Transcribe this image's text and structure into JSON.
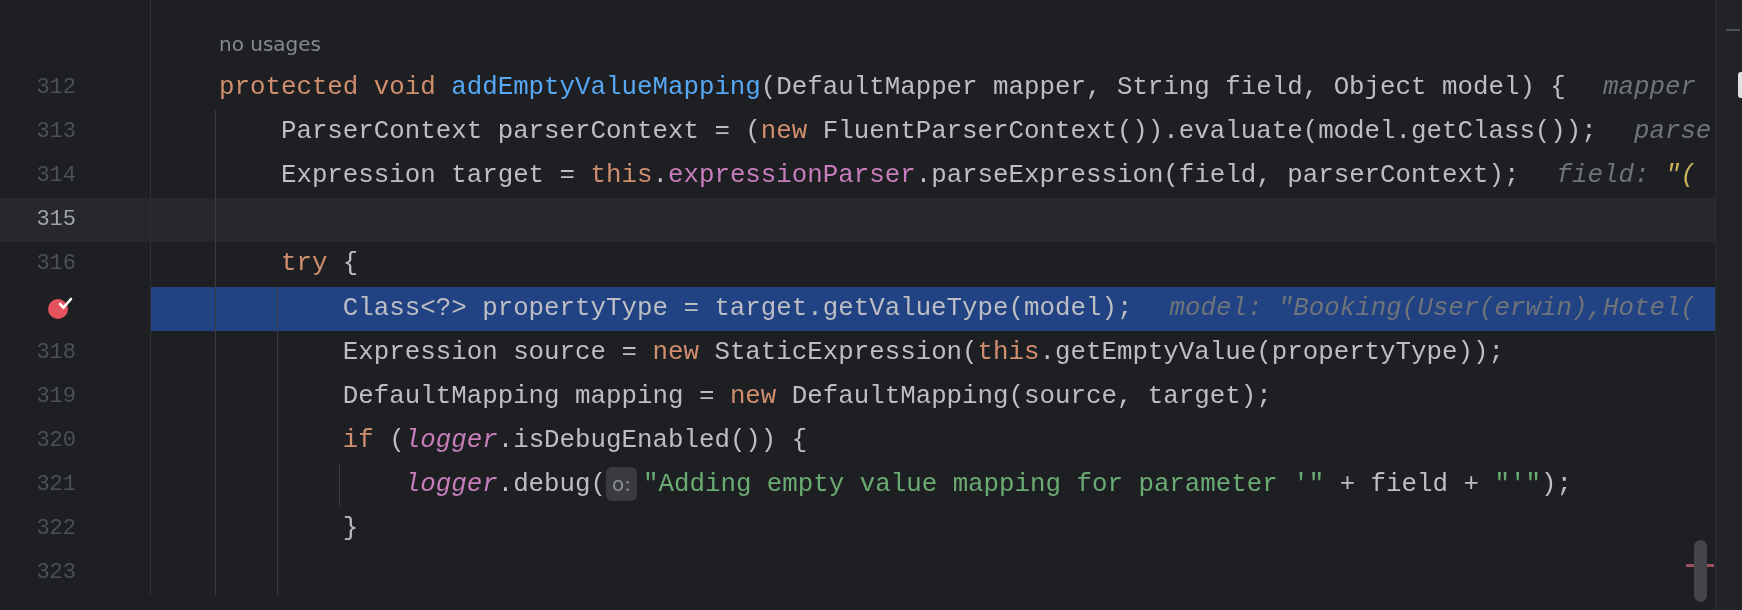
{
  "editor": {
    "lines": [
      {
        "kind": "usage_hint",
        "text": "no usages"
      },
      {
        "kind": "code",
        "number": "312",
        "current": false,
        "selected": false,
        "breakpoint": false,
        "tokens": [
          {
            "kind": "keyword",
            "text": "protected "
          },
          {
            "kind": "keyword",
            "text": "void "
          },
          {
            "kind": "declaration",
            "text": "addEmptyValueMapping"
          },
          {
            "kind": "plain",
            "text": "(DefaultMapper mapper, String field, Object model) {"
          }
        ],
        "inlay": [
          {
            "kind": "name",
            "text": "mapper"
          }
        ]
      },
      {
        "kind": "code",
        "number": "313",
        "current": false,
        "selected": false,
        "breakpoint": false,
        "tokens": [
          {
            "kind": "plain",
            "text": "    ParserContext parserContext = ("
          },
          {
            "kind": "keyword",
            "text": "new"
          },
          {
            "kind": "plain",
            "text": " FluentParserContext()).evaluate(model.getClass());"
          }
        ],
        "inlay": [
          {
            "kind": "name",
            "text": "parse"
          }
        ]
      },
      {
        "kind": "code",
        "number": "314",
        "current": false,
        "selected": false,
        "breakpoint": false,
        "tokens": [
          {
            "kind": "plain",
            "text": "    Expression target = "
          },
          {
            "kind": "keyword",
            "text": "this"
          },
          {
            "kind": "plain",
            "text": "."
          },
          {
            "kind": "field",
            "text": "expressionParser"
          },
          {
            "kind": "plain",
            "text": ".parseExpression(field, parserContext);"
          }
        ],
        "inlay": [
          {
            "kind": "name",
            "text": "field: "
          },
          {
            "kind": "value",
            "text": "\"("
          }
        ]
      },
      {
        "kind": "code",
        "number": "315",
        "current": true,
        "selected": false,
        "breakpoint": false
      },
      {
        "kind": "code",
        "number": "316",
        "current": false,
        "selected": false,
        "breakpoint": false,
        "tokens": [
          {
            "kind": "keyword",
            "text": "    try"
          },
          {
            "kind": "plain",
            "text": " {"
          }
        ]
      },
      {
        "kind": "code",
        "current": false,
        "selected": true,
        "breakpoint": true,
        "tokens": [
          {
            "kind": "plain",
            "text": "        Class<?> propertyType = target.getValueType(model);"
          }
        ],
        "inlay": [
          {
            "kind": "name",
            "text": "model: \"Booking(User(erwin),Hotel("
          }
        ]
      },
      {
        "kind": "code",
        "number": "318",
        "current": false,
        "selected": false,
        "breakpoint": false,
        "tokens": [
          {
            "kind": "plain",
            "text": "        Expression source = "
          },
          {
            "kind": "keyword",
            "text": "new"
          },
          {
            "kind": "plain",
            "text": " StaticExpression("
          },
          {
            "kind": "keyword",
            "text": "this"
          },
          {
            "kind": "plain",
            "text": ".getEmptyValue(propertyType));"
          }
        ]
      },
      {
        "kind": "code",
        "number": "319",
        "current": false,
        "selected": false,
        "breakpoint": false,
        "tokens": [
          {
            "kind": "plain",
            "text": "        DefaultMapping mapping = "
          },
          {
            "kind": "keyword",
            "text": "new"
          },
          {
            "kind": "plain",
            "text": " DefaultMapping(source, target);"
          }
        ]
      },
      {
        "kind": "code",
        "number": "320",
        "current": false,
        "selected": false,
        "breakpoint": false,
        "tokens": [
          {
            "kind": "keyword",
            "text": "        if"
          },
          {
            "kind": "plain",
            "text": " ("
          },
          {
            "kind": "static_field",
            "text": "logger"
          },
          {
            "kind": "plain",
            "text": ".isDebugEnabled()) {"
          }
        ]
      },
      {
        "kind": "code",
        "number": "321",
        "current": false,
        "selected": false,
        "breakpoint": false,
        "tokens": [
          {
            "kind": "static_field",
            "text": "            logger"
          },
          {
            "kind": "plain",
            "text": ".debug("
          },
          {
            "kind": "param_hint",
            "text": "o:"
          },
          {
            "kind": "string",
            "text": "\"Adding empty value mapping for parameter '\""
          },
          {
            "kind": "plain",
            "text": " + field + "
          },
          {
            "kind": "string",
            "text": "\"'\""
          },
          {
            "kind": "plain",
            "text": ");"
          }
        ]
      },
      {
        "kind": "code",
        "number": "322",
        "current": false,
        "selected": false,
        "breakpoint": false,
        "tokens": [
          {
            "kind": "plain",
            "text": "        }"
          }
        ]
      },
      {
        "kind": "code",
        "number": "323",
        "current": false,
        "selected": false,
        "breakpoint": false
      }
    ]
  }
}
